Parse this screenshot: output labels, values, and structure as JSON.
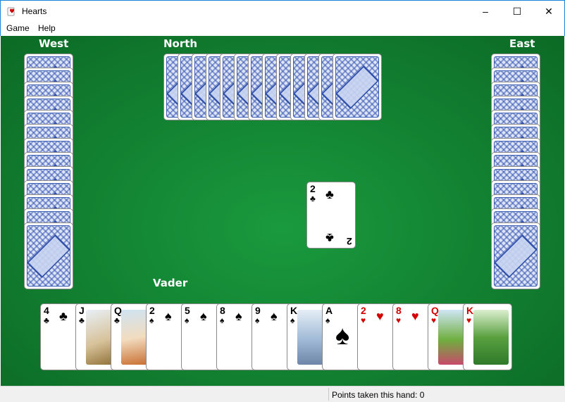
{
  "window": {
    "title": "Hearts"
  },
  "controls": {
    "minimize": "–",
    "maximize": "☐",
    "close": "✕"
  },
  "menu": [
    "Game",
    "Help"
  ],
  "players": {
    "west": "West",
    "north": "North",
    "east": "East",
    "south": "Vader"
  },
  "trick": {
    "card": {
      "rank": "2",
      "suit": "♣"
    }
  },
  "hand": [
    {
      "rank": "4",
      "suit": "♣",
      "color": "black"
    },
    {
      "rank": "J",
      "suit": "♣",
      "color": "black"
    },
    {
      "rank": "Q",
      "suit": "♣",
      "color": "black"
    },
    {
      "rank": "2",
      "suit": "♠",
      "color": "black"
    },
    {
      "rank": "5",
      "suit": "♠",
      "color": "black"
    },
    {
      "rank": "8",
      "suit": "♠",
      "color": "black"
    },
    {
      "rank": "9",
      "suit": "♠",
      "color": "black"
    },
    {
      "rank": "K",
      "suit": "♠",
      "color": "black"
    },
    {
      "rank": "A",
      "suit": "♠",
      "color": "black"
    },
    {
      "rank": "2",
      "suit": "♥",
      "color": "red"
    },
    {
      "rank": "8",
      "suit": "♥",
      "color": "red"
    },
    {
      "rank": "Q",
      "suit": "♥",
      "color": "red"
    },
    {
      "rank": "K",
      "suit": "♥",
      "color": "red"
    }
  ],
  "status": {
    "points": "Points taken this hand: 0"
  }
}
